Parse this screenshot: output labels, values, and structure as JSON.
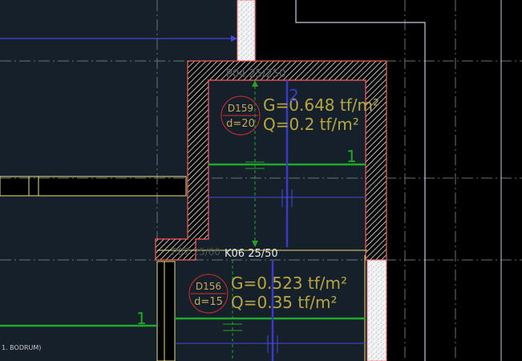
{
  "colors": {
    "background": "#16202a",
    "black_fill": "#000000",
    "wall_hatch": "#ffffff",
    "wall_border": "#ff5a5a",
    "slab_text": "#b8a640",
    "rebar_green": "#1fa82a",
    "rebar_blue": "#3a3ac8",
    "dim_line": "#5a5ae0",
    "grid_dash": "#7a8088",
    "column_yellow": "#e8e070",
    "beam_label_gray": "#6a7078",
    "circle_red": "#d03030"
  },
  "labels": {
    "beam_top_label": "P04 25/250",
    "beam_mid_label": "K06 25/50",
    "beam_mid_ghost": "P07 25/60",
    "floor_label": "1. BODRUM)"
  },
  "slabs": [
    {
      "id": "D159",
      "thickness": "d=20",
      "G": "G=0.648 tf/m²",
      "Q": "Q=0.2 tf/m²",
      "rebar_mark": "1",
      "beam_mark": "2"
    },
    {
      "id": "D156",
      "thickness": "d=15",
      "G": "G=0.523 tf/m²",
      "Q": "Q=0.35 tf/m²",
      "rebar_mark": "1"
    }
  ]
}
